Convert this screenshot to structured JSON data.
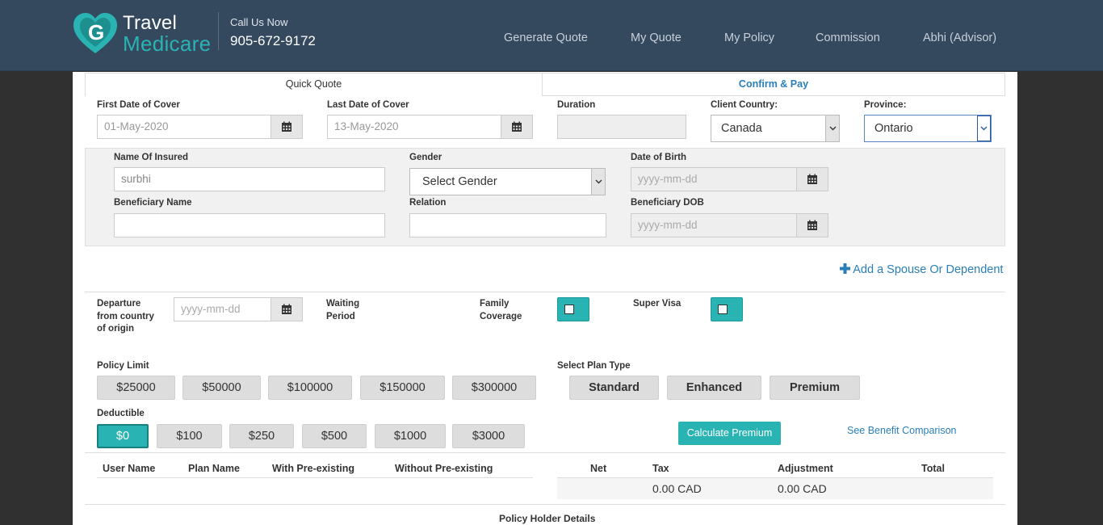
{
  "header": {
    "logo_line1": "Travel",
    "logo_line2": "Medicare",
    "call_label": "Call Us Now",
    "phone": "905-672-9172",
    "nav": [
      "Generate Quote",
      "My Quote",
      "My Policy",
      "Commission",
      "Abhi (Advisor)"
    ]
  },
  "tabs": {
    "quick_quote": "Quick Quote",
    "confirm_pay": "Confirm & Pay"
  },
  "cover": {
    "first_label": "First Date of Cover",
    "first_value": "01-May-2020",
    "last_label": "Last Date of Cover",
    "last_value": "13-May-2020",
    "duration_label": "Duration",
    "duration_value": "",
    "country_label": "Client Country:",
    "country_value": "Canada",
    "province_label": "Province:",
    "province_value": "Ontario"
  },
  "insured": {
    "name_label": "Name Of Insured",
    "name_value": "surbhi",
    "gender_label": "Gender",
    "gender_value": "Select Gender",
    "dob_label": "Date of Birth",
    "dob_placeholder": "yyyy-mm-dd",
    "beneficiary_label": "Beneficiary Name",
    "relation_label": "Relation",
    "beneficiary_dob_label": "Beneficiary DOB",
    "beneficiary_dob_placeholder": "yyyy-mm-dd"
  },
  "add_link": "Add a Spouse Or Dependent",
  "options": {
    "departure_label": "Departure from country of origin",
    "departure_placeholder": "yyyy-mm-dd",
    "waiting_label": "Waiting Period",
    "family_label": "Family Coverage",
    "family_checked": false,
    "supervisa_label": "Super Visa",
    "supervisa_checked": false
  },
  "policy_limit": {
    "label": "Policy Limit",
    "options": [
      "$25000",
      "$50000",
      "$100000",
      "$150000",
      "$300000"
    ]
  },
  "plan_type": {
    "label": "Select Plan Type",
    "options": [
      "Standard",
      "Enhanced",
      "Premium"
    ]
  },
  "deductible": {
    "label": "Deductible",
    "options": [
      "$0",
      "$100",
      "$250",
      "$500",
      "$1000",
      "$3000"
    ],
    "selected": "$0"
  },
  "calculate_button": "Calculate Premium",
  "see_comparison": "See Benefit Comparison",
  "results": {
    "left_headers": [
      "User Name",
      "Plan Name",
      "With Pre-existing",
      "Without Pre-existing"
    ],
    "right_headers": [
      "Net",
      "Tax",
      "Adjustment",
      "Total"
    ],
    "row": {
      "net": "",
      "tax": "0.00 CAD",
      "adjustment": "0.00 CAD",
      "total": ""
    }
  },
  "policy_holder_title": "Policy Holder Details",
  "colors": {
    "header_bg": "#34495e",
    "accent": "#2ab3b3",
    "link": "#2a7fb8"
  }
}
